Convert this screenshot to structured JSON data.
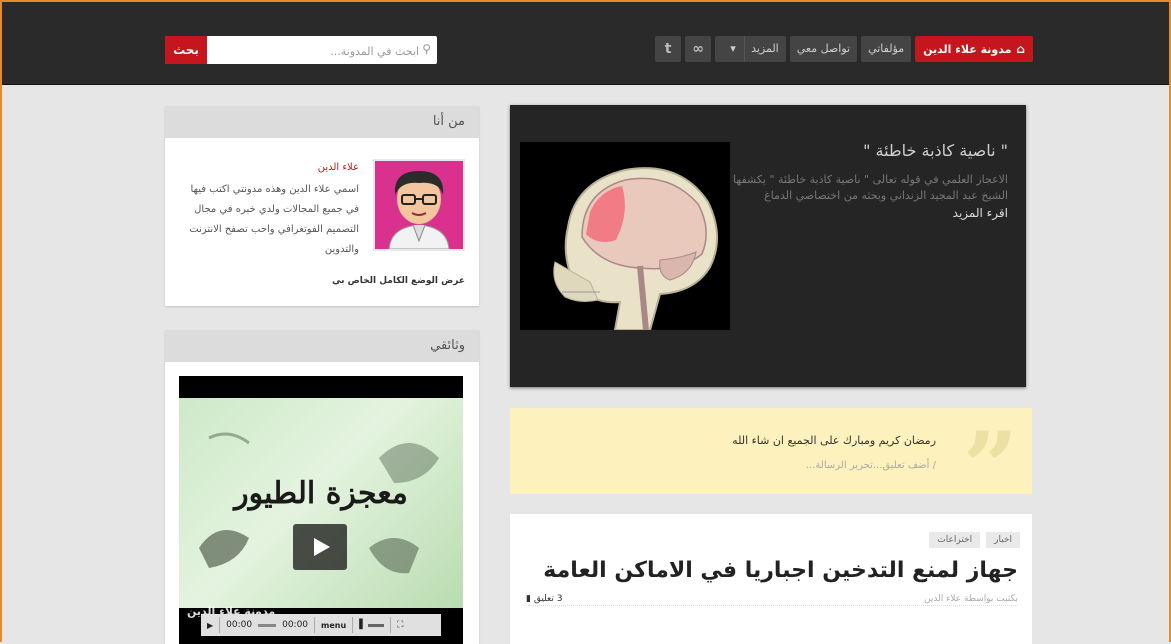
{
  "nav": {
    "home_label": "مدونة علاء الدين",
    "items": [
      "مؤلفاتي",
      "تواصل معي",
      "المزيد"
    ],
    "social": [
      "rss-icon",
      "twitter-icon"
    ]
  },
  "search": {
    "button_label": "بحث",
    "placeholder": "ابحث في المدونة..."
  },
  "slider": {
    "title": "\" ناصية كاذبة خاطئة \"",
    "description": "الاعجاز العلمي في قوله تعالى \" ناصية كاذبة خاطئة \" يكشفها الشيخ عبد المجيد الزنداني وبحثه من اختصاصي الدماغ",
    "read_more": "اقرء المزيد"
  },
  "quote": {
    "text": "رمضان كريم ومبارك على الجميع ان شاء الله",
    "subtext": "/ أضف تعليق...تحرير الرسالة..."
  },
  "post": {
    "tags": [
      "اخبار",
      "اختراعات"
    ],
    "title": "جهاز لمنع التدخين اجباريا في الاماكن العامة",
    "meta": "بكتبت بواسطة علاء الدين",
    "comments": "3 تعليق"
  },
  "about": {
    "header": "من أنا",
    "name": "علاء الدين",
    "bio": "اسمي علاء الدين وهذه مدونتي اكتب فيها في جميع المجالات ولدي خبره في مجال التصميم الفوتغرافي واحب تصفح الانترنت والتدوين",
    "profile_link": "عرض الوضع الكامل الخاص بي"
  },
  "docs": {
    "header": "وثائقي",
    "video_title": "معجزة الطيور",
    "watermark": "مدونة علاء الدين",
    "time_current": "00:00",
    "time_total": "00:00",
    "menu_label": "menu"
  }
}
